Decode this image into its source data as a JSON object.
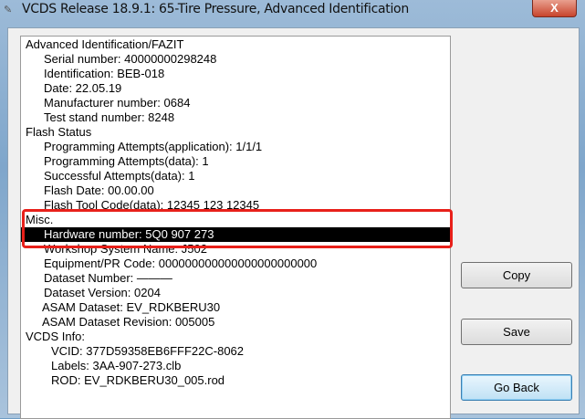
{
  "window": {
    "title": "VCDS Release 18.9.1: 65-Tire Pressure,  Advanced Identification",
    "close_label": "X"
  },
  "lines": [
    {
      "text": "Advanced Identification/FAZIT",
      "indent": 0
    },
    {
      "text": "Serial number: 40000000298248",
      "indent": 1
    },
    {
      "text": "Identification: BEB-018",
      "indent": 1
    },
    {
      "text": "Date: 22.05.19",
      "indent": 1
    },
    {
      "text": "Manufacturer number: 0684",
      "indent": 1
    },
    {
      "text": "Test stand number: 8248",
      "indent": 1
    },
    {
      "text": "Flash Status",
      "indent": 0
    },
    {
      "text": "Programming Attempts(application): 1/1/1",
      "indent": 1
    },
    {
      "text": "Programming Attempts(data): 1",
      "indent": 1
    },
    {
      "text": "Successful Attempts(data): 1",
      "indent": 1
    },
    {
      "text": "Flash Date: 00.00.00",
      "indent": 1
    },
    {
      "text": "Flash Tool Code(data): 12345 123 12345",
      "indent": 1
    },
    {
      "text": "Misc.",
      "indent": 0
    },
    {
      "text": "Hardware number: 5Q0 907 273",
      "indent": 1,
      "selected": true
    },
    {
      "text": "Workshop System Name: J502",
      "indent": 1
    },
    {
      "text": "Equipment/PR Code: 000000000000000000000000",
      "indent": 1
    },
    {
      "text": "Dataset Number: ———",
      "indent": 1
    },
    {
      "text": "Dataset Version: 0204",
      "indent": 1
    },
    {
      "text": "ASAM Dataset: EV_RDKBERU30",
      "indent": 2
    },
    {
      "text": "ASAM Dataset Revision: 005005",
      "indent": 2
    },
    {
      "text": "VCDS Info:",
      "indent": 0
    },
    {
      "text": "VCID: 377D59358EB6FFF22C-8062",
      "indent": 3
    },
    {
      "text": "Labels: 3AA-907-273.clb",
      "indent": 3
    },
    {
      "text": "ROD: EV_RDKBERU30_005.rod",
      "indent": 3
    }
  ],
  "buttons": {
    "copy": "Copy",
    "save": "Save",
    "go_back": "Go Back"
  },
  "colors": {
    "highlight_box": "#e8201a",
    "selection": "#000000"
  }
}
